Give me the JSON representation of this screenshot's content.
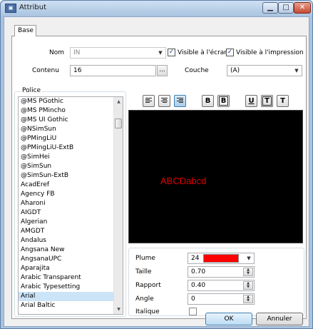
{
  "window": {
    "title": "Attribut",
    "app_icon": "app-icon",
    "minimize": "▁",
    "maximize": "□",
    "close": "✕"
  },
  "tabs": [
    {
      "label": "Base"
    }
  ],
  "base": {
    "nom_label": "Nom",
    "nom_value": "IN",
    "contenu_label": "Contenu",
    "contenu_value": "16",
    "browse_label": "...",
    "visible_ecran_label": "Visible à l'écran",
    "visible_ecran_checked": true,
    "visible_impression_label": "Visible à l'impression",
    "visible_impression_checked": true,
    "couche_label": "Couche",
    "couche_value": "(A)"
  },
  "police": {
    "label": "Police",
    "fonts": [
      "@MS PGothic",
      "@MS PMincho",
      "@MS UI Gothic",
      "@NSimSun",
      "@PMingLiU",
      "@PMingLiU-ExtB",
      "@SimHei",
      "@SimSun",
      "@SimSun-ExtB",
      "AcadEref",
      "Agency FB",
      "Aharoni",
      "AIGDT",
      "Algerian",
      "AMGDT",
      "Andalus",
      "Angsana New",
      "AngsanaUPC",
      "Aparajita",
      "Arabic Transparent",
      "Arabic Typesetting",
      "Arial",
      "Arial Baltic"
    ],
    "selected": "Arial"
  },
  "format_buttons": {
    "align_left": "align-left-icon",
    "align_center": "align-center-icon",
    "align_right": "align-right-icon",
    "bold": "B",
    "bold_outline": "B",
    "underline": "U",
    "overline": "T",
    "tau": "T"
  },
  "preview": {
    "text": "ABCDabcd",
    "text_color": "#e00000",
    "background": "#000000"
  },
  "properties": {
    "plume_label": "Plume",
    "plume_value": "24",
    "plume_color": "#ff0000",
    "taille_label": "Taille",
    "taille_value": "0.70",
    "rapport_label": "Rapport",
    "rapport_value": "0.40",
    "angle_label": "Angle",
    "angle_value": "0",
    "italique_label": "Italique",
    "italique_checked": false
  },
  "dialog_buttons": {
    "ok": "OK",
    "cancel": "Annuler"
  }
}
